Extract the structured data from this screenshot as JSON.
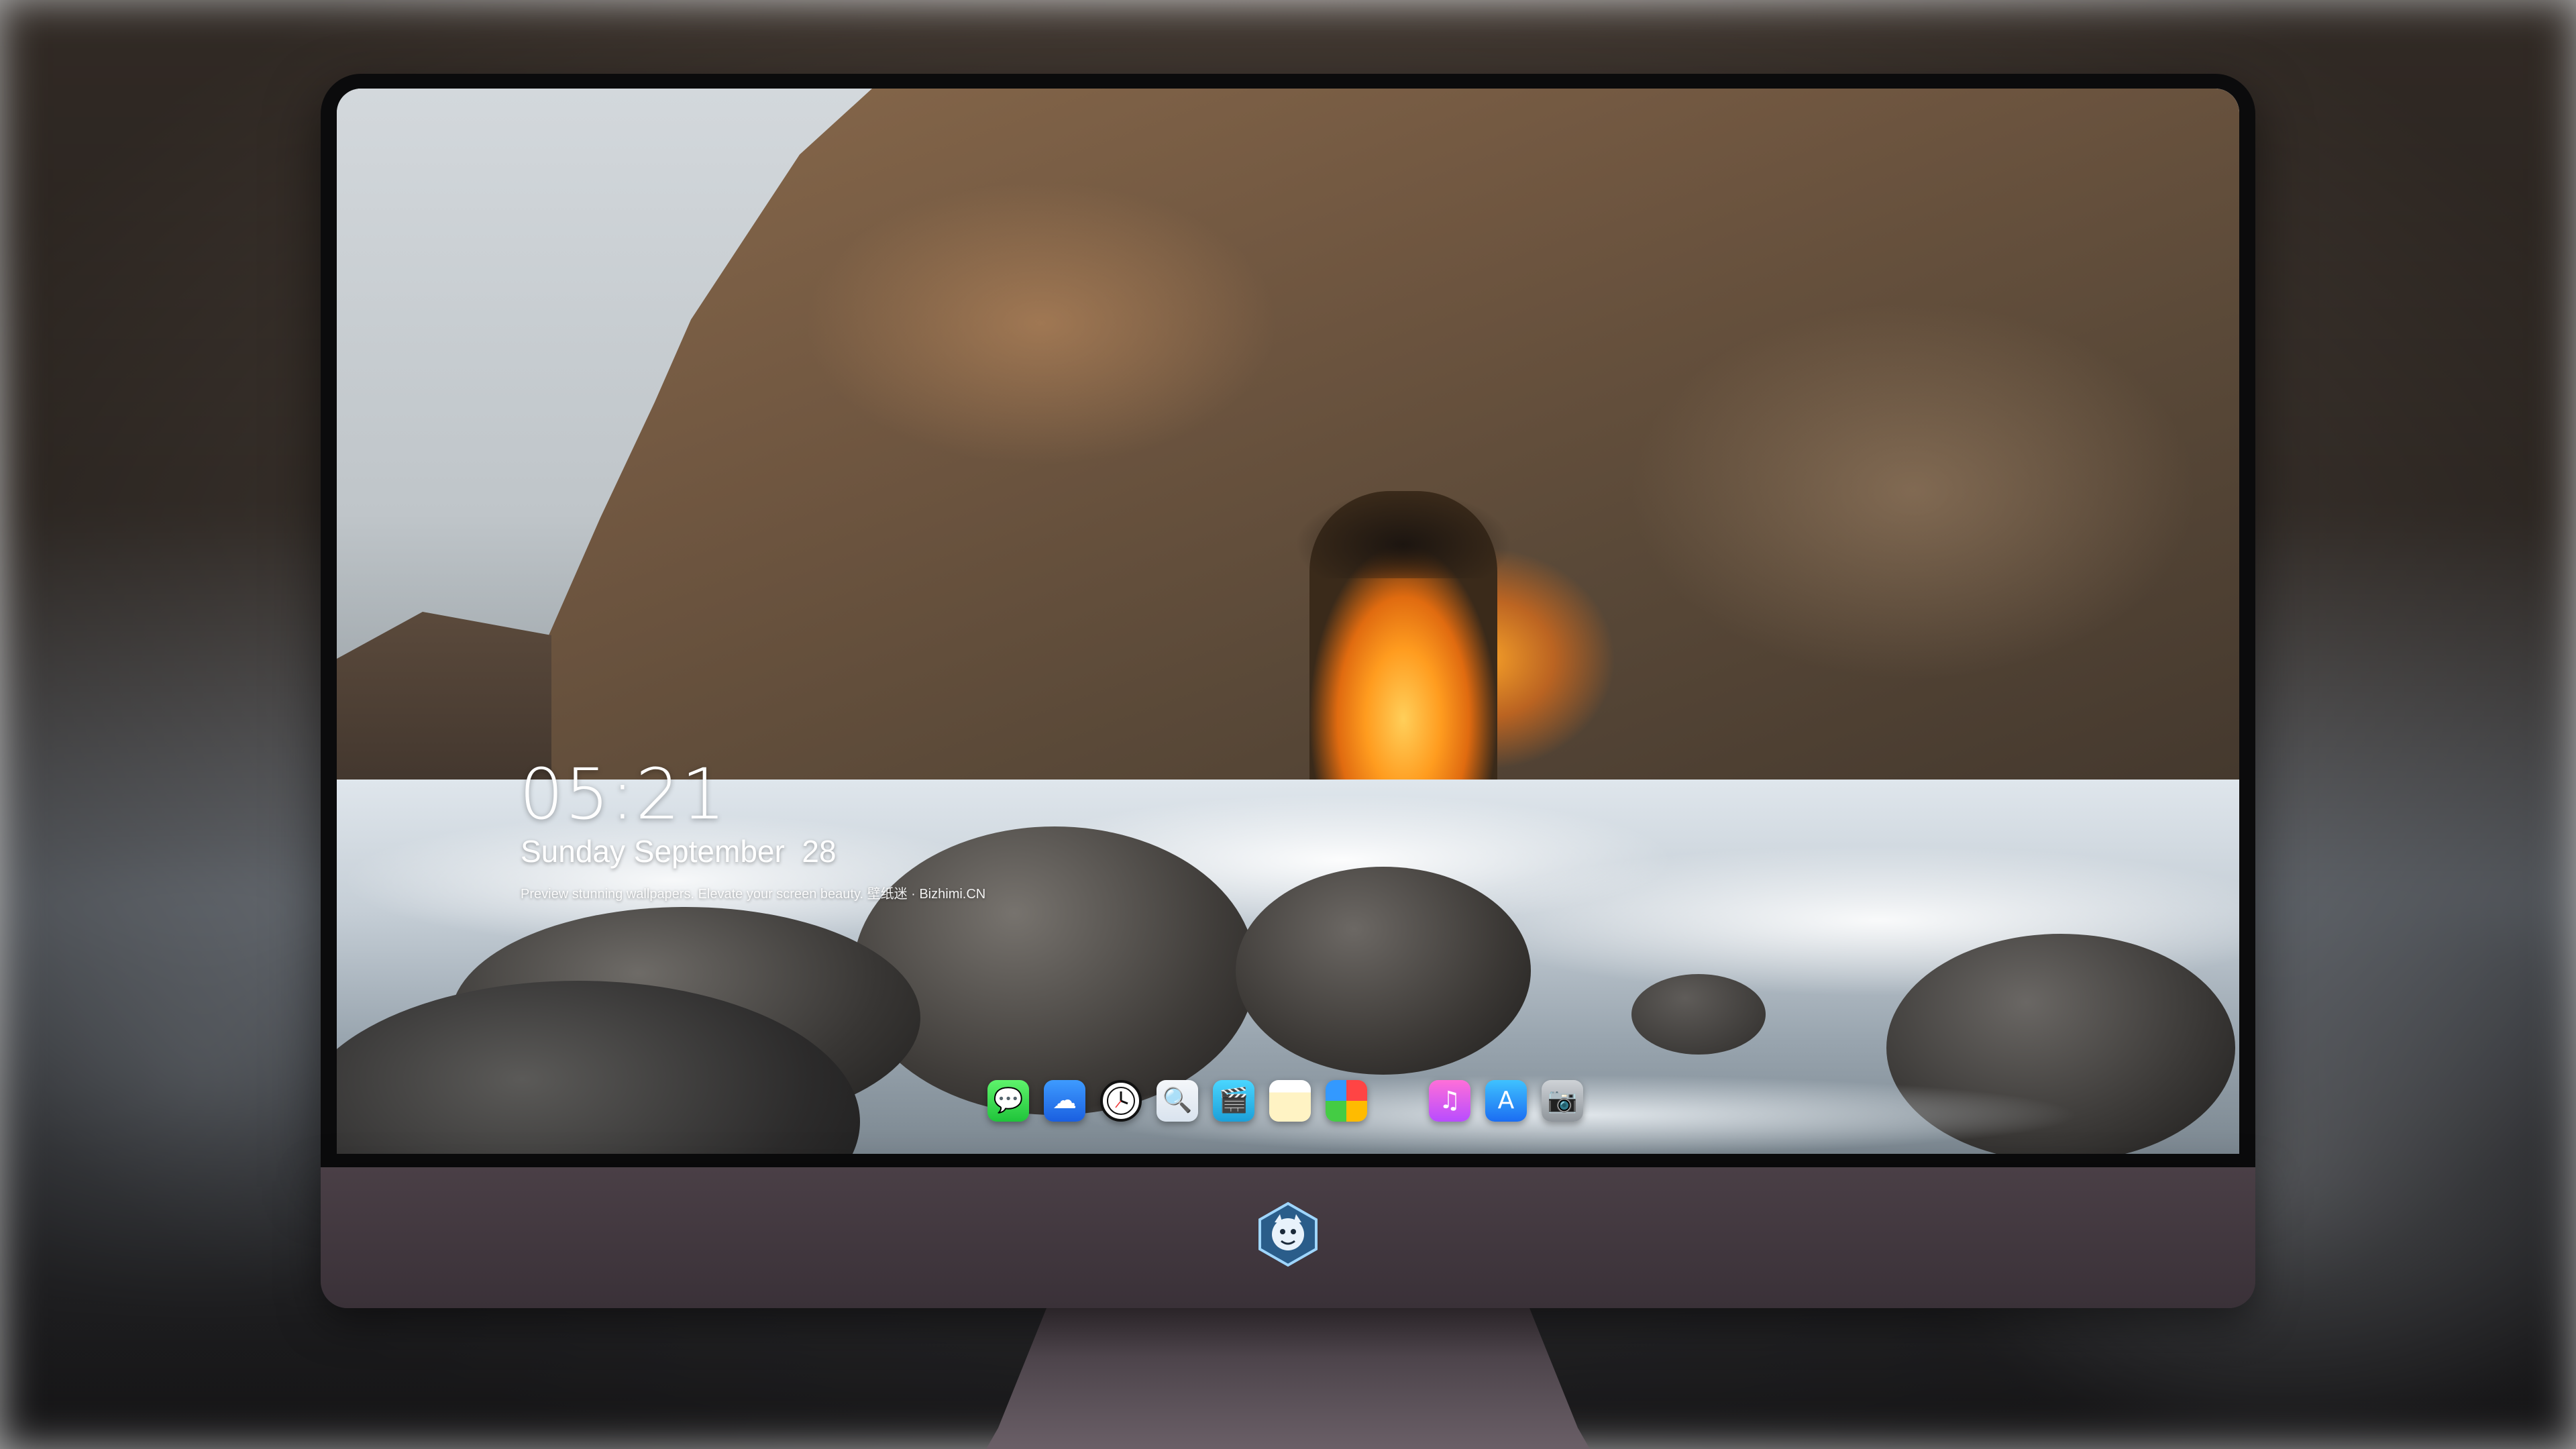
{
  "lock_screen": {
    "time": "05:21",
    "date": "Sunday September  28",
    "tagline": "Preview stunning wallpapers. Elevate your screen beauty. 壁纸迷 · Bizhimi.CN"
  },
  "dock": {
    "apps": [
      {
        "name": "messages-icon",
        "glyph": "💬"
      },
      {
        "name": "weather-icon",
        "glyph": "☁"
      },
      {
        "name": "clock-icon",
        "glyph": "🕔"
      },
      {
        "name": "preview-icon",
        "glyph": "🔍"
      },
      {
        "name": "clips-icon",
        "glyph": "🎬"
      },
      {
        "name": "notes-icon",
        "glyph": ""
      },
      {
        "name": "photos-icon",
        "glyph": ""
      },
      {
        "name": "music-icon",
        "glyph": "♫"
      },
      {
        "name": "app-store-icon",
        "glyph": "A"
      },
      {
        "name": "camera-icon",
        "glyph": "📷"
      }
    ]
  },
  "colors": {
    "monitor_chin": "#4a3f46",
    "bezel": "#0b0b0c",
    "text": "#ffffff"
  }
}
